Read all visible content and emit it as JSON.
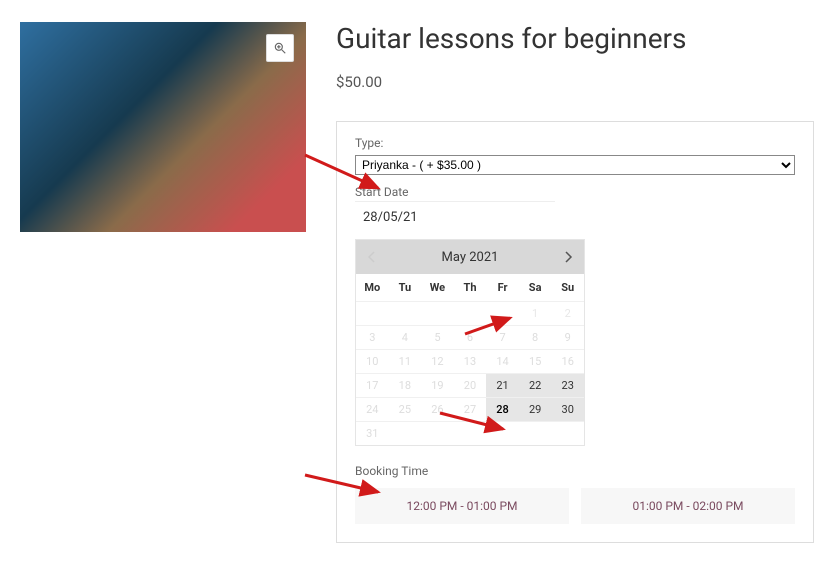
{
  "product": {
    "title": "Guitar lessons for beginners",
    "price": "$50.00"
  },
  "form": {
    "type_label": "Type:",
    "type_selected": "Priyanka - ( + $35.00 )",
    "start_date_label": "Start Date",
    "start_date_value": "28/05/21"
  },
  "calendar": {
    "month_title": "May 2021",
    "dow": [
      "Mo",
      "Tu",
      "We",
      "Th",
      "Fr",
      "Sa",
      "Su"
    ],
    "prev_disabled": true,
    "rows": [
      [
        {
          "n": "",
          "k": "blank"
        },
        {
          "n": "",
          "k": "blank"
        },
        {
          "n": "",
          "k": "blank"
        },
        {
          "n": "",
          "k": "blank"
        },
        {
          "n": "",
          "k": "blank"
        },
        {
          "n": "1",
          "k": "lighter"
        },
        {
          "n": "2",
          "k": "lighter"
        }
      ],
      [
        {
          "n": "3",
          "k": "muted"
        },
        {
          "n": "4",
          "k": "muted"
        },
        {
          "n": "5",
          "k": "muted"
        },
        {
          "n": "6",
          "k": "muted"
        },
        {
          "n": "7",
          "k": "muted"
        },
        {
          "n": "8",
          "k": "muted"
        },
        {
          "n": "9",
          "k": "muted"
        }
      ],
      [
        {
          "n": "10",
          "k": "muted"
        },
        {
          "n": "11",
          "k": "muted"
        },
        {
          "n": "12",
          "k": "muted"
        },
        {
          "n": "13",
          "k": "muted"
        },
        {
          "n": "14",
          "k": "muted"
        },
        {
          "n": "15",
          "k": "muted"
        },
        {
          "n": "16",
          "k": "muted"
        }
      ],
      [
        {
          "n": "17",
          "k": "muted"
        },
        {
          "n": "18",
          "k": "muted"
        },
        {
          "n": "19",
          "k": "muted"
        },
        {
          "n": "20",
          "k": "muted"
        },
        {
          "n": "21",
          "k": "avail"
        },
        {
          "n": "22",
          "k": "avail"
        },
        {
          "n": "23",
          "k": "avail"
        }
      ],
      [
        {
          "n": "24",
          "k": "muted"
        },
        {
          "n": "25",
          "k": "muted"
        },
        {
          "n": "26",
          "k": "muted"
        },
        {
          "n": "27",
          "k": "muted"
        },
        {
          "n": "28",
          "k": "selected"
        },
        {
          "n": "29",
          "k": "avail"
        },
        {
          "n": "30",
          "k": "avail"
        }
      ],
      [
        {
          "n": "31",
          "k": "muted"
        },
        {
          "n": "",
          "k": "blank"
        },
        {
          "n": "",
          "k": "blank"
        },
        {
          "n": "",
          "k": "blank"
        },
        {
          "n": "",
          "k": "blank"
        },
        {
          "n": "",
          "k": "blank"
        },
        {
          "n": "",
          "k": "blank"
        }
      ]
    ]
  },
  "booking_time": {
    "label": "Booking Time",
    "slots": [
      "12:00 PM - 01:00 PM",
      "01:00 PM - 02:00 PM"
    ]
  },
  "arrows": {
    "color": "#d11a1a"
  }
}
